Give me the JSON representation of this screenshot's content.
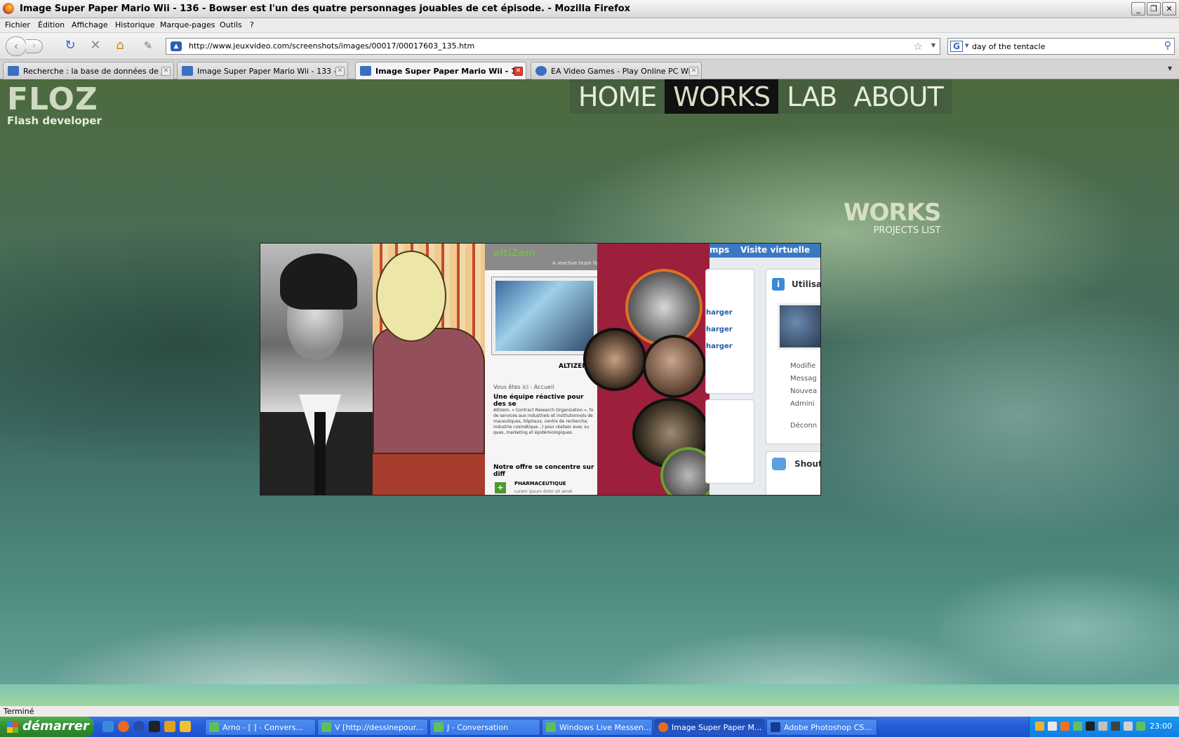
{
  "window": {
    "title": "Image Super Paper Mario Wii - 136 - Bowser est l'un des quatre personnages jouables de cet épisode. - Mozilla Firefox",
    "controls": {
      "minimize": "_",
      "restore": "❐",
      "close": "✕"
    }
  },
  "menu": [
    "Fichier",
    "Édition",
    "Affichage",
    "Historique",
    "Marque-pages",
    "Outils",
    "?"
  ],
  "navigation": {
    "url": "http://www.jeuxvideo.com/screenshots/images/00017/00017603_135.htm",
    "search_engine_icon": "G",
    "search_value": "day of the tentacle"
  },
  "tabs": [
    {
      "label": "Recherche : la base de données de jeu...",
      "active": false
    },
    {
      "label": "Image Super Paper Mario Wii - 133 - La...",
      "active": false
    },
    {
      "label": "Image Super Paper Mario Wii - 1...",
      "active": true
    },
    {
      "label": "EA Video Games - Play Online PC Wii Xb...",
      "active": false
    }
  ],
  "site": {
    "logo_title": "FLOZ",
    "logo_subtitle": "Flash developer",
    "nav": [
      "HOME",
      "WORKS",
      "LAB",
      "ABOUT"
    ],
    "active_nav": "WORKS",
    "section_title": "WORKS",
    "section_subtitle": "PROJECTS LIST",
    "gallery": {
      "altizem_logo": "altiZem",
      "altizem_tagline": "A reactive team for",
      "altizem_label": "ALTIZEM",
      "breadcrumb": "Vous êtes ici : Accueil",
      "heading": "Une équipe réactive pour des se",
      "body": "Altizem, « Contract Research Organization », fo de services aux industriels et institutionnels de maceutiques, hôpitaux, centre de recherche, industrie cosmétique...) pour réaliser avec su ques, marketing et épidémiologiques.",
      "offer": "Notre offre se concentre sur diff",
      "category": "PHARMACEUTIQUE",
      "lorem": "Lorem ipsum dolor sit amet",
      "tab_fragment": "mps",
      "virtual_visit": "Visite virtuelle",
      "download": "harger",
      "users_title": "Utilisa",
      "links": [
        "Modifie",
        "Messag",
        "Nouvea",
        "Admini",
        "Déconn"
      ],
      "shout_title": "Shout"
    }
  },
  "status": "Terminé",
  "taskbar": {
    "start": "démarrer",
    "buttons": [
      {
        "label": "Arno - [   ] - Convers...",
        "active": false
      },
      {
        "label": "V [http://dessinepour...",
        "active": false
      },
      {
        "label": "J - Conversation",
        "active": false
      },
      {
        "label": "Windows Live Messen...",
        "active": false
      },
      {
        "label": "Image Super Paper M...",
        "active": true
      },
      {
        "label": "Adobe Photoshop CS...",
        "active": false
      }
    ],
    "clock": "23:00"
  }
}
